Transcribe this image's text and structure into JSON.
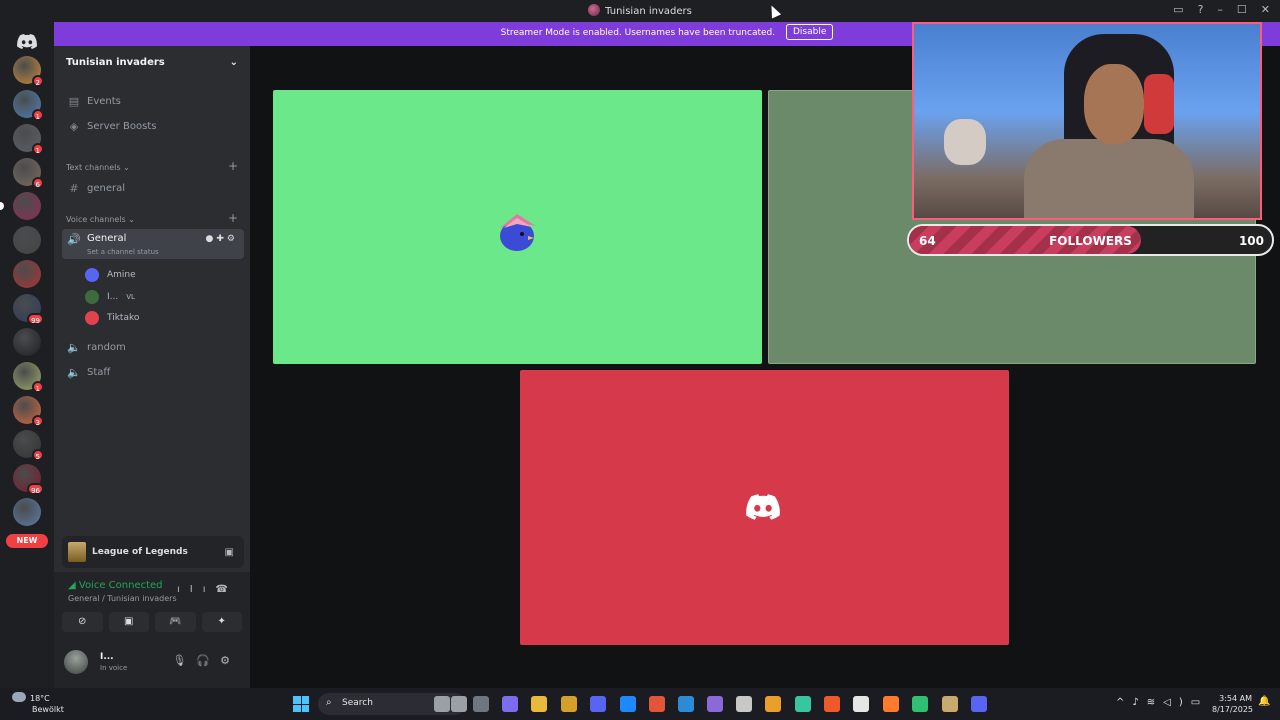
{
  "window": {
    "title": "Tunisian invaders",
    "controls": [
      "▭",
      "?",
      "–",
      "☐",
      "✕"
    ]
  },
  "banner": {
    "text": "Streamer Mode is enabled. Usernames have been truncated.",
    "button": "Disable"
  },
  "rail": {
    "new_label": "NEW",
    "servers": [
      {
        "badge": "2",
        "color": "#c98a3a"
      },
      {
        "badge": "1",
        "color": "#4d7fb3"
      },
      {
        "badge": "1",
        "color": "#5b5f66"
      },
      {
        "badge": "6",
        "color": "#7a6a5c"
      },
      {
        "badge": "",
        "color": "#8b2f4f"
      },
      {
        "badge": "",
        "color": "#444"
      },
      {
        "badge": "",
        "color": "#a33"
      },
      {
        "badge": "99",
        "color": "#2f3b5c"
      },
      {
        "badge": "",
        "color": "#1e1f22"
      },
      {
        "badge": "1",
        "color": "#9aa866"
      },
      {
        "badge": "3",
        "color": "#d4683c"
      },
      {
        "badge": "5",
        "color": "#333"
      },
      {
        "badge": "96",
        "color": "#7a1c2a"
      },
      {
        "badge": "",
        "color": "#5a7aa3"
      }
    ]
  },
  "sidebar": {
    "server_name": "Tunisian invaders",
    "events": "Events",
    "boosts": "Server Boosts",
    "text_cat": "Text channels",
    "text_channel": "general",
    "voice_cat": "Voice channels",
    "voice_general": "General",
    "channel_status": "Set a channel status",
    "voice_users": [
      {
        "name": "Amine",
        "extra": "",
        "color": "#5865f2"
      },
      {
        "name": "I...",
        "extra": "VL",
        "color": "#3d6b3d"
      },
      {
        "name": "Tiktako",
        "extra": "",
        "color": "#e0434e"
      }
    ],
    "random": "random",
    "staff": "Staff"
  },
  "activity": {
    "game": "League of Legends"
  },
  "voice_panel": {
    "status": "Voice Connected",
    "location": "General / Tunisian invaders"
  },
  "user": {
    "name": "I...",
    "status": "In voice"
  },
  "overlay": {
    "followers_label": "FOLLOWERS",
    "current": "64",
    "goal": "100",
    "progress": 0.64
  },
  "taskbar": {
    "temp": "18°C",
    "weather": "Bewölkt",
    "search": "Search",
    "time": "3:54 AM",
    "date": "8/17/2025"
  }
}
